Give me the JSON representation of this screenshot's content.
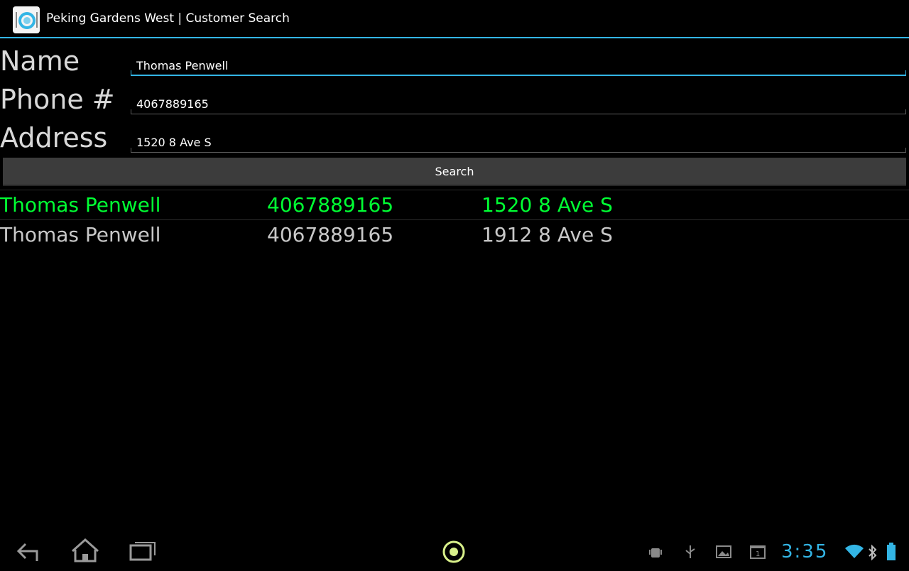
{
  "app": {
    "title": "Peking Gardens West | Customer Search",
    "icon": "plate-icon"
  },
  "form": {
    "name_label": "Name",
    "phone_label": "Phone #",
    "address_label": "Address",
    "name_value": "Thomas Penwell",
    "phone_value": "4067889165",
    "address_value": "1520 8 Ave S",
    "search_label": "Search"
  },
  "results": [
    {
      "name": "Thomas Penwell",
      "phone": "4067889165",
      "address": "1520 8 Ave S",
      "selected": true
    },
    {
      "name": "Thomas Penwell",
      "phone": "4067889165",
      "address": "1912 8 Ave S",
      "selected": false
    }
  ],
  "system_bar": {
    "time": "3:35",
    "icons": [
      "back-icon",
      "home-icon",
      "recent-apps-icon",
      "app-drawer-icon",
      "debug-icon",
      "usb-icon",
      "gallery-icon",
      "calendar-icon",
      "wifi-icon",
      "bluetooth-icon",
      "battery-icon"
    ],
    "calendar_day": "1"
  },
  "colors": {
    "accent": "#33b5e5",
    "selected_row": "#00ff33",
    "background": "#000000"
  }
}
